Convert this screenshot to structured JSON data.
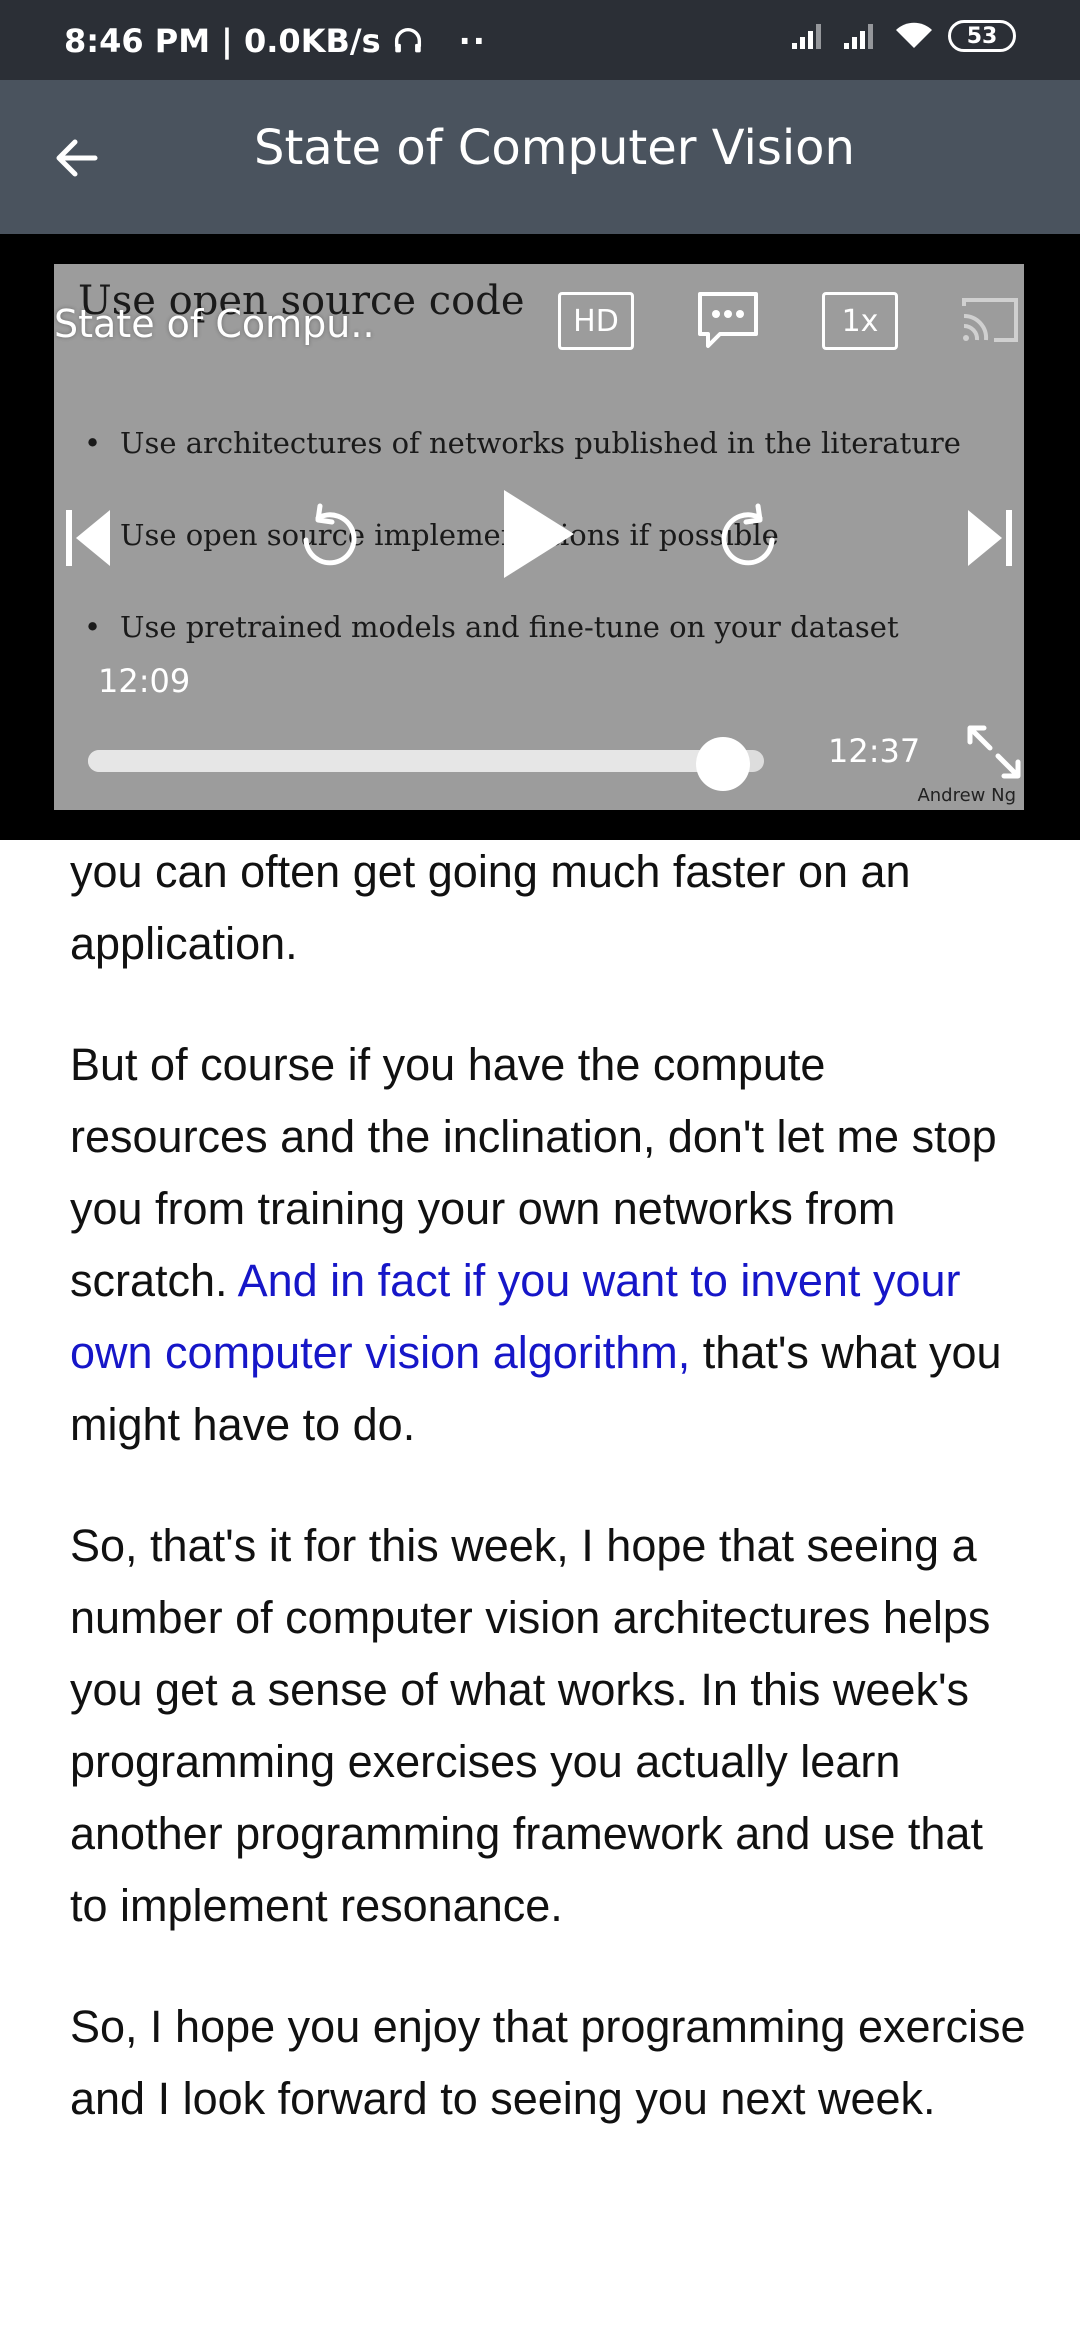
{
  "status_bar": {
    "time": "8:46 PM | 0.0KB/s",
    "dots": "··",
    "battery": "53"
  },
  "app_bar": {
    "title": "State of Computer Vision"
  },
  "video": {
    "title_overlay": "State of Compu..",
    "slide_heading": "Use open source code",
    "bullets": [
      "Use architectures of networks published in the literature",
      "Use open source implementations if possible",
      "Use pretrained models and fine-tune on your dataset"
    ],
    "hd_label": "HD",
    "speed_label": "1x",
    "current_time": "12:09",
    "duration": "12:37",
    "progress": 0.94,
    "watermark": "Andrew Ng"
  },
  "transcript": {
    "paragraphs": [
      {
        "before": "you can often get going much faster on an application.",
        "highlight": "",
        "after": ""
      },
      {
        "before": "But of course if you have the compute resources and the inclination, don't let me stop you from training your own networks from scratch. ",
        "highlight": "And in fact if you want to in­vent your own computer vision algorithm,",
        "after": " that's what you might have to do."
      },
      {
        "before": "So, that's it for this week, I hope that seeing a number of computer vision architectures helps you get a sense of what works. In this week's programming exercises you actually learn another programming framework and use that to implement resonance.",
        "highlight": "",
        "after": ""
      },
      {
        "before": "So, I hope you enjoy that programming exercise and I look forward to seeing you next week.",
        "highlight": "",
        "after": ""
      }
    ]
  },
  "colors": {
    "status_bar_bg": "#2b2f36",
    "app_bar_bg": "#4a535e",
    "highlight": "#1616c8"
  }
}
